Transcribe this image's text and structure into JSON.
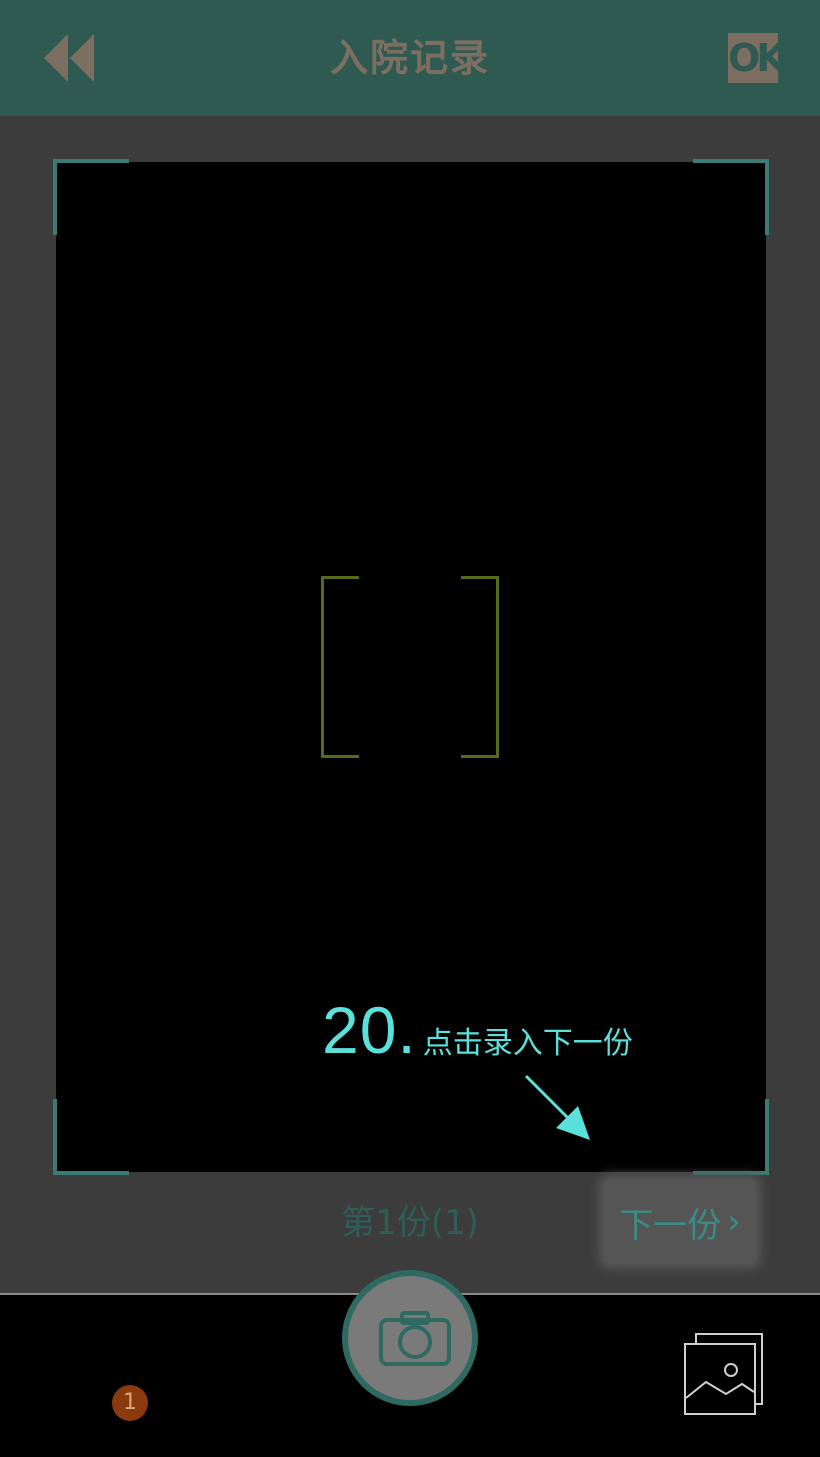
{
  "header": {
    "title": "入院记录",
    "ok_label": "OK"
  },
  "viewfinder": {
    "annotation_number": "20.",
    "annotation_text": "点击录入下一份"
  },
  "footer": {
    "page_indicator": "第1份(1)",
    "next_label": "下一份",
    "badge_count": "1"
  },
  "colors": {
    "header_bg": "#2f5a52",
    "accent_teal": "#5be1db",
    "badge_bg": "#8a3a0c"
  },
  "icons": [
    "rewind-icon",
    "ok-icon",
    "camera-icon",
    "gallery-icon",
    "chevron-right-icon",
    "arrow-annotation-icon"
  ]
}
